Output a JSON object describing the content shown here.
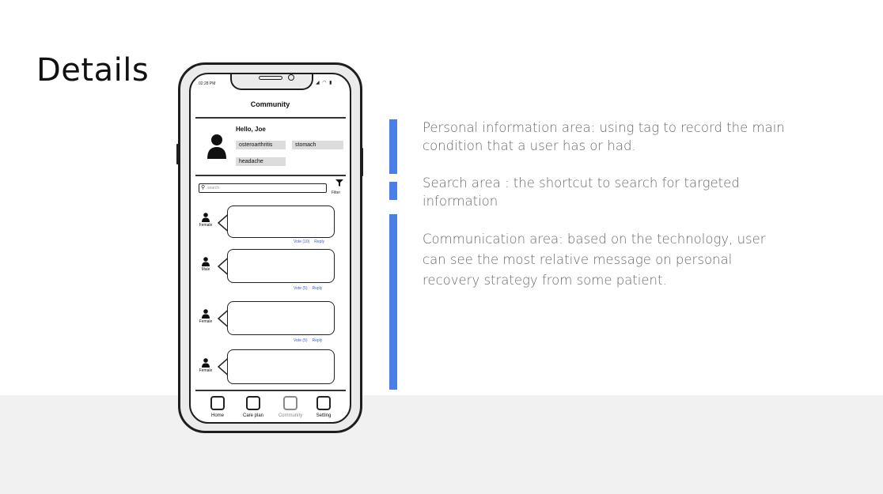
{
  "slide": {
    "title": "Details"
  },
  "phone": {
    "status_time": "02:28 PM",
    "status_icons": "◢ ◠ ▮",
    "header_title": "Community",
    "profile": {
      "greeting": "Hello, Joe",
      "tags": [
        "osteroarthritis",
        "stomach",
        "headache"
      ]
    },
    "search": {
      "placeholder": "search",
      "filter_label": "Filter"
    },
    "posts": [
      {
        "gender": "Female",
        "vote": "Vote (10)",
        "reply": "Reply"
      },
      {
        "gender": "Male",
        "vote": "Vote (5)",
        "reply": "Reply"
      },
      {
        "gender": "Female",
        "vote": "Vote (5)",
        "reply": "Reply"
      },
      {
        "gender": "Female"
      }
    ],
    "nav": [
      {
        "label": "Home"
      },
      {
        "label": "Care plan"
      },
      {
        "label": "Community",
        "active": true
      },
      {
        "label": "Setting"
      }
    ]
  },
  "annotations": [
    {
      "text": "Personal information area:  using tag to record the main condition that a user has or had."
    },
    {
      "text": "Search area : the shortcut to search for targeted information"
    },
    {
      "text": "Communication area: based on the technology, user can see the most relative message on personal recovery strategy from some patient."
    }
  ],
  "colors": {
    "accent_bar": "#4a7fe8",
    "link": "#3b5bdb",
    "annotation_text": "#6a6a6a",
    "bottom_band": "#f1f1f1"
  }
}
